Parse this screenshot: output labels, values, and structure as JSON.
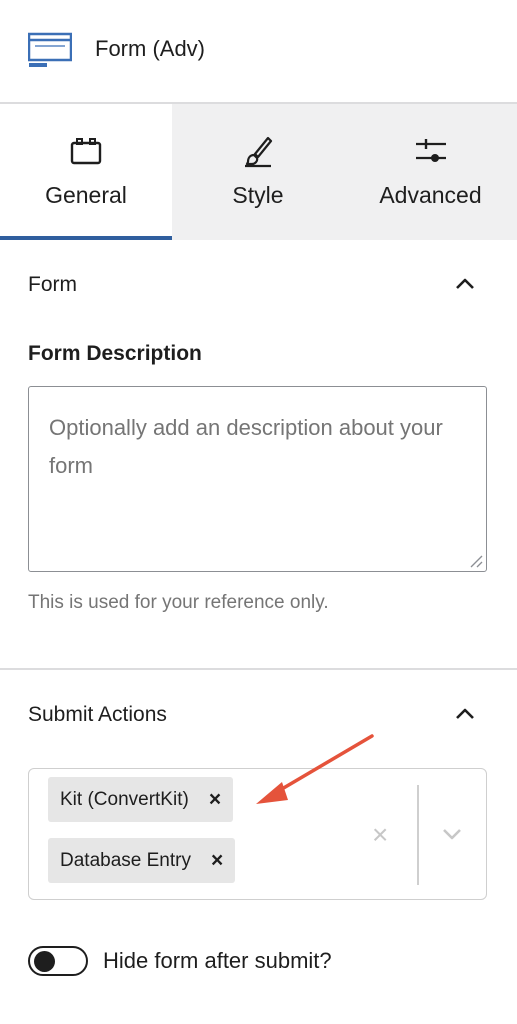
{
  "header": {
    "title": "Form (Adv)",
    "icon": "form-block-icon"
  },
  "tabs": [
    {
      "label": "General",
      "icon": "general-icon",
      "active": true
    },
    {
      "label": "Style",
      "icon": "brush-icon",
      "active": false
    },
    {
      "label": "Advanced",
      "icon": "sliders-icon",
      "active": false
    }
  ],
  "form_section": {
    "title": "Form",
    "description_label": "Form Description",
    "description_value": "",
    "description_placeholder": "Optionally add an description about your form",
    "help_text": "This is used for your reference only."
  },
  "submit_section": {
    "title": "Submit Actions",
    "actions": [
      {
        "label": "Kit (ConvertKit)",
        "remove": "×"
      },
      {
        "label": "Database Entry",
        "remove": "×"
      }
    ],
    "clear_all": "×"
  },
  "hide_toggle": {
    "label": "Hide form after submit?",
    "checked": false
  },
  "colors": {
    "accent": "#2f5e9e",
    "annotation_arrow": "#e5533b",
    "icon_blue": "#3b6fb6"
  }
}
